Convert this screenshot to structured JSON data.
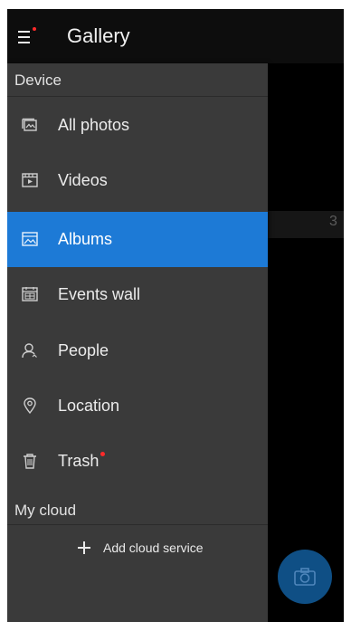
{
  "appbar": {
    "title": "Gallery"
  },
  "drawer": {
    "device_header": "Device",
    "items": [
      {
        "label": "All photos",
        "icon": "photos-icon"
      },
      {
        "label": "Videos",
        "icon": "video-icon"
      },
      {
        "label": "Albums",
        "icon": "album-icon",
        "selected": true
      },
      {
        "label": "Events wall",
        "icon": "events-wall-icon"
      },
      {
        "label": "People",
        "icon": "person-icon"
      },
      {
        "label": "Location",
        "icon": "location-pin-icon"
      },
      {
        "label": "Trash",
        "icon": "trash-icon",
        "badge": "new-dot"
      }
    ],
    "cloud_header": "My cloud",
    "add_cloud_label": "Add cloud service"
  },
  "background": {
    "album_count": "3"
  },
  "colors": {
    "accent": "#1d7ad6",
    "drawer_bg": "#3a3a3a",
    "badge": "#ff2a2a",
    "fab": "#0f4f85"
  }
}
